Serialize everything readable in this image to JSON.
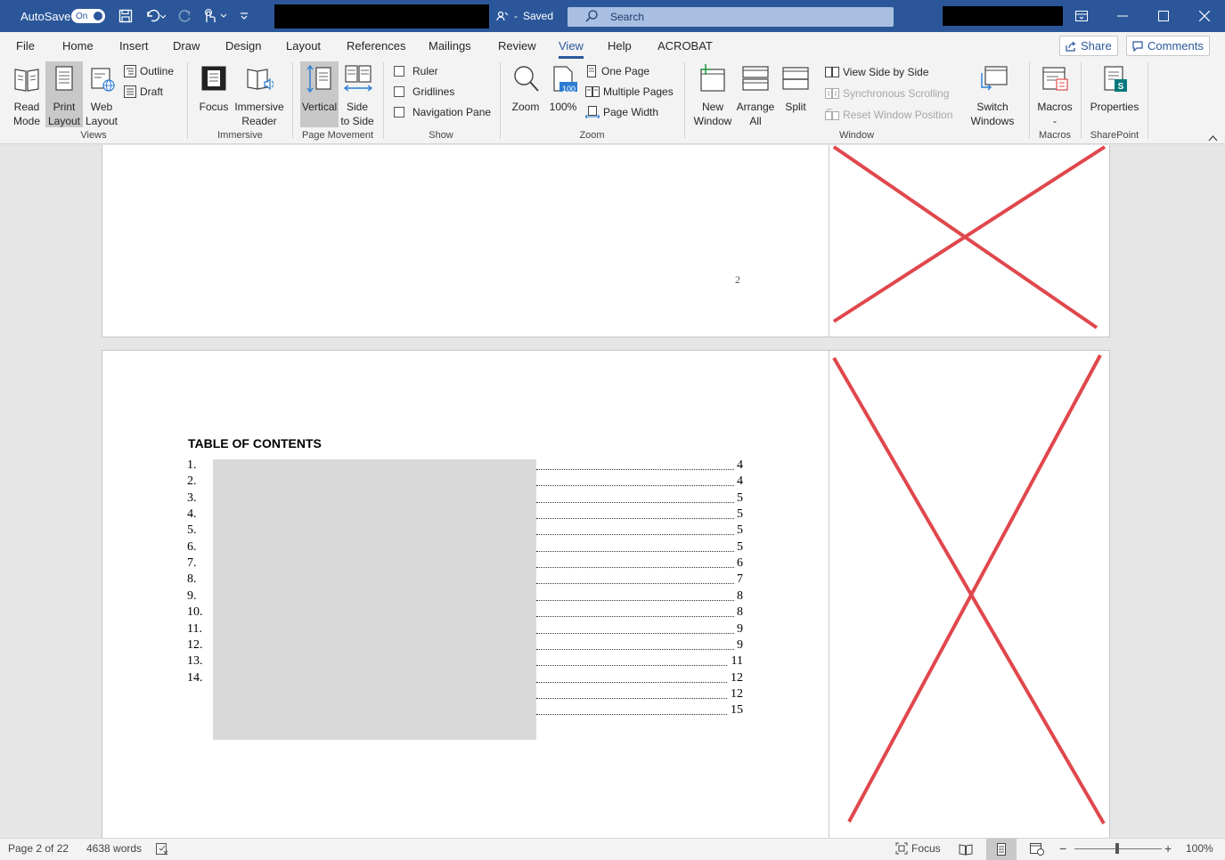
{
  "titlebar": {
    "autosave_label": "AutoSave",
    "autosave_state": "On",
    "save_status": "Saved",
    "search_placeholder": "Search",
    "accent_color": "#2b579a"
  },
  "tabs": [
    {
      "label": "File"
    },
    {
      "label": "Home"
    },
    {
      "label": "Insert"
    },
    {
      "label": "Draw"
    },
    {
      "label": "Design"
    },
    {
      "label": "Layout"
    },
    {
      "label": "References"
    },
    {
      "label": "Mailings"
    },
    {
      "label": "Review"
    },
    {
      "label": "View"
    },
    {
      "label": "Help"
    },
    {
      "label": "ACROBAT"
    }
  ],
  "header_actions": {
    "share": "Share",
    "comments": "Comments"
  },
  "ribbon": {
    "views": {
      "label": "Views",
      "read_mode": [
        "Read",
        "Mode"
      ],
      "print_layout": [
        "Print",
        "Layout"
      ],
      "web_layout": [
        "Web",
        "Layout"
      ],
      "outline": "Outline",
      "draft": "Draft"
    },
    "immersive": {
      "label": "Immersive",
      "focus": "Focus",
      "reader": [
        "Immersive",
        "Reader"
      ]
    },
    "page_movement": {
      "label": "Page Movement",
      "vertical": "Vertical",
      "side": [
        "Side",
        "to Side"
      ]
    },
    "show": {
      "label": "Show",
      "ruler": "Ruler",
      "gridlines": "Gridlines",
      "nav_pane": "Navigation Pane"
    },
    "zoom": {
      "label": "Zoom",
      "zoom": "Zoom",
      "hundred": "100%",
      "hundred_badge": "100",
      "one_page": "One Page",
      "multiple_pages": "Multiple Pages",
      "page_width": "Page Width"
    },
    "window": {
      "label": "Window",
      "new_window": [
        "New",
        "Window"
      ],
      "arrange_all": [
        "Arrange",
        "All"
      ],
      "split": "Split",
      "side_by_side": "View Side by Side",
      "sync_scroll": "Synchronous Scrolling",
      "reset_pos": "Reset Window Position",
      "switch": [
        "Switch",
        "Windows"
      ]
    },
    "macros": {
      "label": "Macros",
      "macros": "Macros"
    },
    "sharepoint": {
      "label": "SharePoint",
      "properties": "Properties"
    }
  },
  "document": {
    "page_number": "2",
    "toc_title": "TABLE OF CONTENTS",
    "toc_numbers": [
      "1.",
      "2.",
      "3.",
      "4.",
      "5.",
      "6.",
      "7.",
      "8.",
      "9.",
      "10.",
      "11.",
      "12.",
      "13.",
      "14."
    ],
    "toc_pages": [
      "4",
      "4",
      "5",
      "5",
      "5",
      "5",
      "6",
      "7",
      "8",
      "8",
      "9",
      "9",
      "11",
      "12",
      "12",
      "15"
    ],
    "cross_color": "#e0474c"
  },
  "statusbar": {
    "page": "Page 2 of 22",
    "words": "4638 words",
    "focus": "Focus",
    "zoom_minus": "−",
    "zoom_plus": "+",
    "zoom_level": "100%"
  }
}
